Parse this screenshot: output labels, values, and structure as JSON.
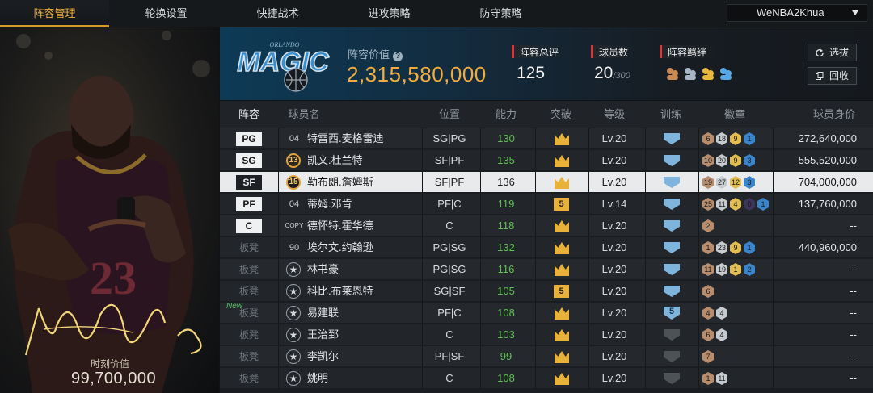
{
  "nav": {
    "tabs": [
      "阵容管理",
      "轮换设置",
      "快捷战术",
      "进攻策略",
      "防守策略"
    ],
    "active_tab": 0,
    "username": "WeNBA2Khua"
  },
  "featured": {
    "jersey_number": "23",
    "market_value_label": "时刻价值",
    "market_value": "99,700,000"
  },
  "team": {
    "logo_small_text": "ORLANDO",
    "logo_text": "MAGIC",
    "value_label": "阵容价值",
    "value": "2,315,580,000",
    "overall_label": "阵容总评",
    "overall": "125",
    "count_label": "球员数",
    "count": "20",
    "count_max": "/300",
    "chemistry_label": "阵容羁绊",
    "select_button": "选拔",
    "recycle_button": "回收"
  },
  "table": {
    "headers": [
      "阵容",
      "球员名",
      "位置",
      "能力",
      "突破",
      "等级",
      "训练",
      "徽章",
      "球员身价"
    ],
    "rows": [
      {
        "slot": "PG",
        "jersey": "04",
        "jersey_type": "plain",
        "name": "特雷西.麦格雷迪",
        "position": "SG|PG",
        "rating": "130",
        "rating_green": true,
        "breakthrough": "crown",
        "level": "Lv.20",
        "training": "shield",
        "badges": [
          [
            "b",
            "6"
          ],
          [
            "s",
            "18"
          ],
          [
            "g",
            "9"
          ],
          [
            "p",
            "1"
          ]
        ],
        "salary": "272,640,000"
      },
      {
        "slot": "SG",
        "jersey": "13",
        "jersey_type": "badge",
        "name": "凯文.杜兰特",
        "position": "SF|PF",
        "rating": "135",
        "rating_green": true,
        "breakthrough": "crown",
        "level": "Lv.20",
        "training": "shield",
        "badges": [
          [
            "b",
            "10"
          ],
          [
            "s",
            "20"
          ],
          [
            "g",
            "9"
          ],
          [
            "p",
            "3"
          ]
        ],
        "salary": "555,520,000"
      },
      {
        "slot": "SF",
        "jersey": "15",
        "jersey_type": "badge",
        "name": "勒布朗.詹姆斯",
        "position": "SF|PF",
        "rating": "136",
        "rating_green": false,
        "breakthrough": "crown",
        "level": "Lv.20",
        "training": "shield",
        "badges": [
          [
            "b",
            "19"
          ],
          [
            "s",
            "27"
          ],
          [
            "g",
            "12"
          ],
          [
            "p",
            "3"
          ]
        ],
        "salary": "704,000,000",
        "selected": true
      },
      {
        "slot": "PF",
        "jersey": "04",
        "jersey_type": "plain",
        "name": "蒂姆.邓肯",
        "position": "PF|C",
        "rating": "119",
        "rating_green": true,
        "breakthrough": "5",
        "level": "Lv.14",
        "training": "shield",
        "badges": [
          [
            "b",
            "25"
          ],
          [
            "s",
            "11"
          ],
          [
            "g",
            "4"
          ],
          [
            "v",
            "0"
          ],
          [
            "p",
            "1"
          ]
        ],
        "salary": "137,760,000"
      },
      {
        "slot": "C",
        "jersey": "COPY",
        "jersey_type": "plain",
        "name": "德怀特.霍华德",
        "position": "C",
        "rating": "118",
        "rating_green": true,
        "breakthrough": "crown",
        "level": "Lv.20",
        "training": "shield",
        "badges": [
          [
            "b",
            "2"
          ]
        ],
        "salary": "--"
      },
      {
        "slot": "板凳",
        "jersey": "90",
        "jersey_type": "plain",
        "name": "埃尔文.约翰逊",
        "position": "PG|SG",
        "rating": "132",
        "rating_green": true,
        "breakthrough": "crown",
        "level": "Lv.20",
        "training": "shield",
        "badges": [
          [
            "b",
            "1"
          ],
          [
            "s",
            "23"
          ],
          [
            "g",
            "9"
          ],
          [
            "p",
            "1"
          ]
        ],
        "salary": "440,960,000"
      },
      {
        "slot": "板凳",
        "jersey": "",
        "jersey_type": "star",
        "name": "林书豪",
        "position": "PG|SG",
        "rating": "116",
        "rating_green": true,
        "breakthrough": "crown",
        "level": "Lv.20",
        "training": "shield",
        "badges": [
          [
            "b",
            "11"
          ],
          [
            "s",
            "19"
          ],
          [
            "g",
            "1"
          ],
          [
            "p",
            "2"
          ]
        ],
        "salary": "--"
      },
      {
        "slot": "板凳",
        "jersey": "",
        "jersey_type": "star",
        "name": "科比.布莱恩特",
        "position": "SG|SF",
        "rating": "105",
        "rating_green": true,
        "breakthrough": "5",
        "level": "Lv.20",
        "training": "shield",
        "badges": [
          [
            "b",
            "6"
          ]
        ],
        "salary": "--"
      },
      {
        "slot": "板凳",
        "new": "New",
        "jersey": "",
        "jersey_type": "star",
        "name": "易建联",
        "position": "PF|C",
        "rating": "108",
        "rating_green": true,
        "breakthrough": "crown",
        "level": "Lv.20",
        "training": "5",
        "badges": [
          [
            "b",
            "4"
          ],
          [
            "s",
            "4"
          ]
        ],
        "salary": "--"
      },
      {
        "slot": "板凳",
        "jersey": "",
        "jersey_type": "star",
        "name": "王治郅",
        "position": "C",
        "rating": "103",
        "rating_green": true,
        "breakthrough": "crown",
        "level": "Lv.20",
        "training": "dark",
        "badges": [
          [
            "b",
            "6"
          ],
          [
            "s",
            "4"
          ]
        ],
        "salary": "--"
      },
      {
        "slot": "板凳",
        "jersey": "",
        "jersey_type": "star",
        "name": "李凯尔",
        "position": "PF|SF",
        "rating": "99",
        "rating_green": true,
        "breakthrough": "crown",
        "level": "Lv.20",
        "training": "dark",
        "badges": [
          [
            "b",
            "7"
          ]
        ],
        "salary": "--"
      },
      {
        "slot": "板凳",
        "jersey": "",
        "jersey_type": "star",
        "name": "姚明",
        "position": "C",
        "rating": "108",
        "rating_green": true,
        "breakthrough": "crown",
        "level": "Lv.20",
        "training": "dark",
        "badges": [
          [
            "b",
            "1"
          ],
          [
            "s",
            "11"
          ]
        ],
        "salary": "--"
      }
    ]
  }
}
